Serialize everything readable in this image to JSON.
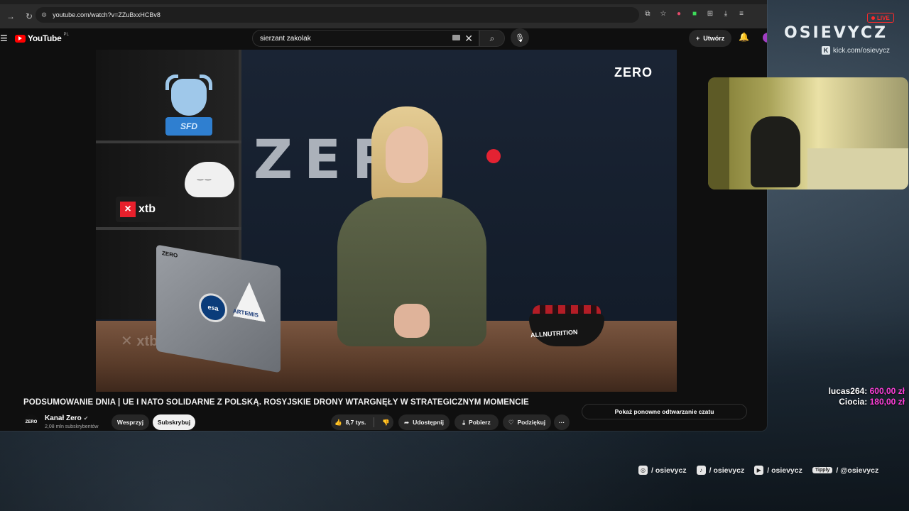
{
  "browser": {
    "url": "youtube.com/watch?v=ZZuBxxHCBv8"
  },
  "youtube": {
    "logo_text": "YouTube",
    "region": "PL",
    "search_value": "sierzant zakolak",
    "create_label": "Utwórz"
  },
  "video": {
    "wall_text": "ZER",
    "corner_logo": "ZERO",
    "sign_text": "xtb",
    "trophy_text": "SFD",
    "laptop_label": "ZERO",
    "sticker_esa": "esa",
    "sticker_artemis": "ARTEMIS",
    "bowl_label": "ALLNUTRITION",
    "title": "PODSUMOWANIE DNIA | UE I NATO SOLIDARNE Z POLSKĄ. ROSYJSKIE DRONY WTARGNĘŁY W STRATEGICZNYM MOMENCIE"
  },
  "channel": {
    "avatar_text": "ZERO",
    "name": "Kanał Zero",
    "subscribers": "2,08 mln subskrybentów",
    "support_label": "Wesprzyj",
    "subscribe_label": "Subskrybuj"
  },
  "actions": {
    "likes": "8,7 tys.",
    "share": "Udostępnij",
    "download": "Pobierz",
    "thanks": "Podziękuj",
    "more": "···"
  },
  "chat": {
    "replay_label": "Pokaż ponowne odtwarzanie czatu"
  },
  "overlay": {
    "live": "LIVE",
    "brand": "OSIEVYCZ",
    "kick_icon": "K",
    "kick_url": "kick.com/osievycz",
    "donations": [
      {
        "name": "lucas264:",
        "amount": "600,00 zł"
      },
      {
        "name": "Ciocia:",
        "amount": "180,00 zł"
      }
    ],
    "socials": [
      {
        "icon": "instagram-icon",
        "glyph": "◎",
        "handle": "/ osievycz"
      },
      {
        "icon": "tiktok-icon",
        "glyph": "♪",
        "handle": "/ osievycz"
      },
      {
        "icon": "youtube-icon",
        "glyph": "▶",
        "handle": "/ osievycz"
      },
      {
        "icon": "tipply-icon",
        "glyph": "Tipply",
        "handle": "/ @osievycz"
      }
    ]
  },
  "colors": {
    "youtube_red": "#ff0000",
    "donation_amount": "#ff3fd9",
    "live_red": "#ff2a2a"
  }
}
